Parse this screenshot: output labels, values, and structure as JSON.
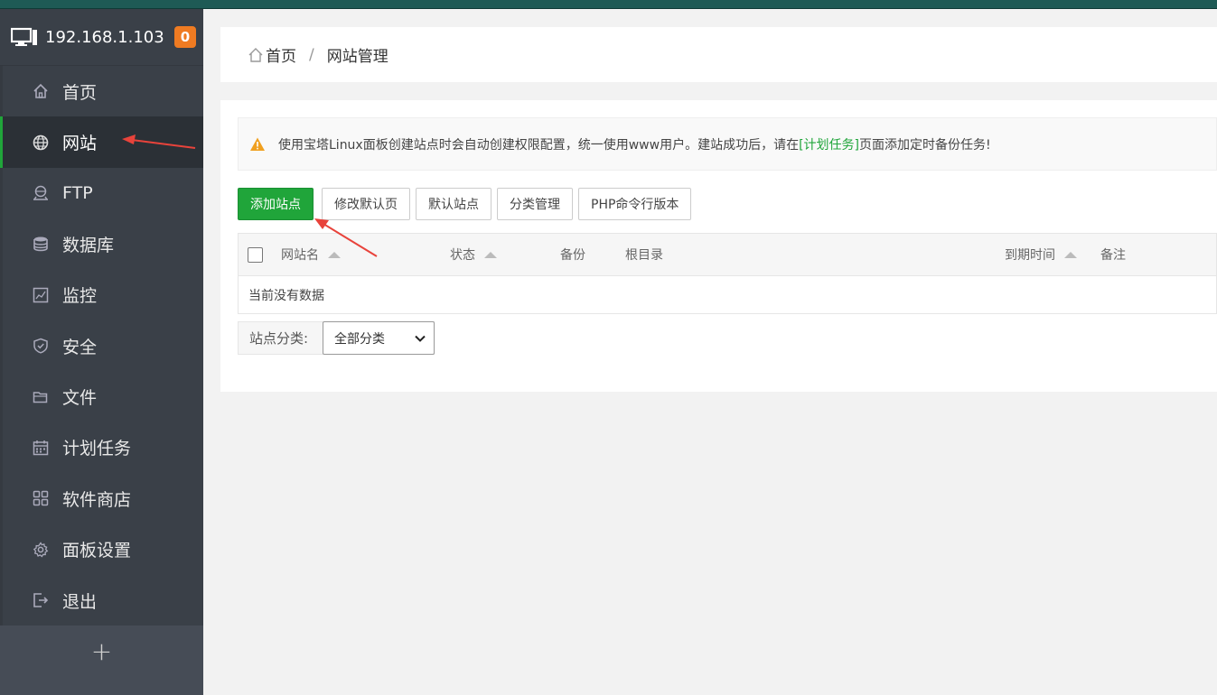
{
  "server": {
    "ip": "192.168.1.103",
    "badge_count": "0"
  },
  "sidebar": {
    "items": [
      {
        "label": "首页",
        "icon": "home-icon"
      },
      {
        "label": "网站",
        "icon": "globe-icon",
        "active": true
      },
      {
        "label": "FTP",
        "icon": "ftp-icon"
      },
      {
        "label": "数据库",
        "icon": "database-icon"
      },
      {
        "label": "监控",
        "icon": "monitor-icon"
      },
      {
        "label": "安全",
        "icon": "shield-icon"
      },
      {
        "label": "文件",
        "icon": "folder-icon"
      },
      {
        "label": "计划任务",
        "icon": "calendar-icon"
      },
      {
        "label": "软件商店",
        "icon": "apps-icon"
      },
      {
        "label": "面板设置",
        "icon": "gear-icon"
      },
      {
        "label": "退出",
        "icon": "logout-icon"
      }
    ],
    "add_label": "+"
  },
  "breadcrumb": {
    "home": "首页",
    "separator": "/",
    "current": "网站管理"
  },
  "notice": {
    "text_before": "使用宝塔Linux面板创建站点时会自动创建权限配置，统一使用www用户。建站成功后，请在",
    "link": "[计划任务]",
    "text_after": "页面添加定时备份任务!"
  },
  "toolbar": {
    "add_site": "添加站点",
    "modify_default_page": "修改默认页",
    "default_site": "默认站点",
    "category_manage": "分类管理",
    "php_cli_version": "PHP命令行版本"
  },
  "table": {
    "headers": {
      "name": "网站名",
      "status": "状态",
      "backup": "备份",
      "root": "根目录",
      "expire": "到期时间",
      "remark": "备注"
    },
    "empty_text": "当前没有数据"
  },
  "filter": {
    "label": "站点分类:",
    "selected": "全部分类"
  },
  "colors": {
    "accent": "#20a53a",
    "sidebar_bg": "#3a4048",
    "badge": "#ef7b22",
    "annotation_arrow": "#e8433b"
  }
}
